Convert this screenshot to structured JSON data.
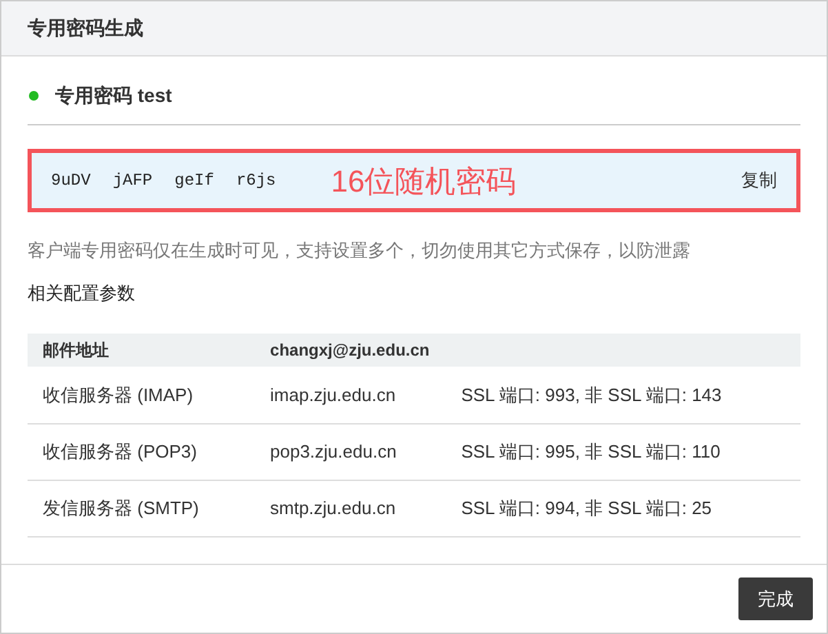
{
  "dialog": {
    "title": "专用密码生成"
  },
  "status": {
    "color": "#22bb22",
    "label": "专用密码 test"
  },
  "password": {
    "groups": [
      "9uDV",
      "jAFP",
      "geIf",
      "r6js"
    ],
    "annotation": "16位随机密码",
    "copy": "复制"
  },
  "hint": "客户端专用密码仅在生成时可见，支持设置多个，切勿使用其它方式保存，以防泄露",
  "section_title": "相关配置参数",
  "table": {
    "header": [
      "邮件地址",
      "changxj@zju.edu.cn"
    ],
    "rows": [
      [
        "收信服务器 (IMAP)",
        "imap.zju.edu.cn",
        "SSL 端口: 993, 非 SSL 端口: 143"
      ],
      [
        "收信服务器 (POP3)",
        "pop3.zju.edu.cn",
        "SSL 端口: 995, 非 SSL 端口: 110"
      ],
      [
        "发信服务器 (SMTP)",
        "smtp.zju.edu.cn",
        "SSL 端口: 994, 非 SSL 端口: 25"
      ]
    ]
  },
  "buttons": [
    "完成"
  ]
}
